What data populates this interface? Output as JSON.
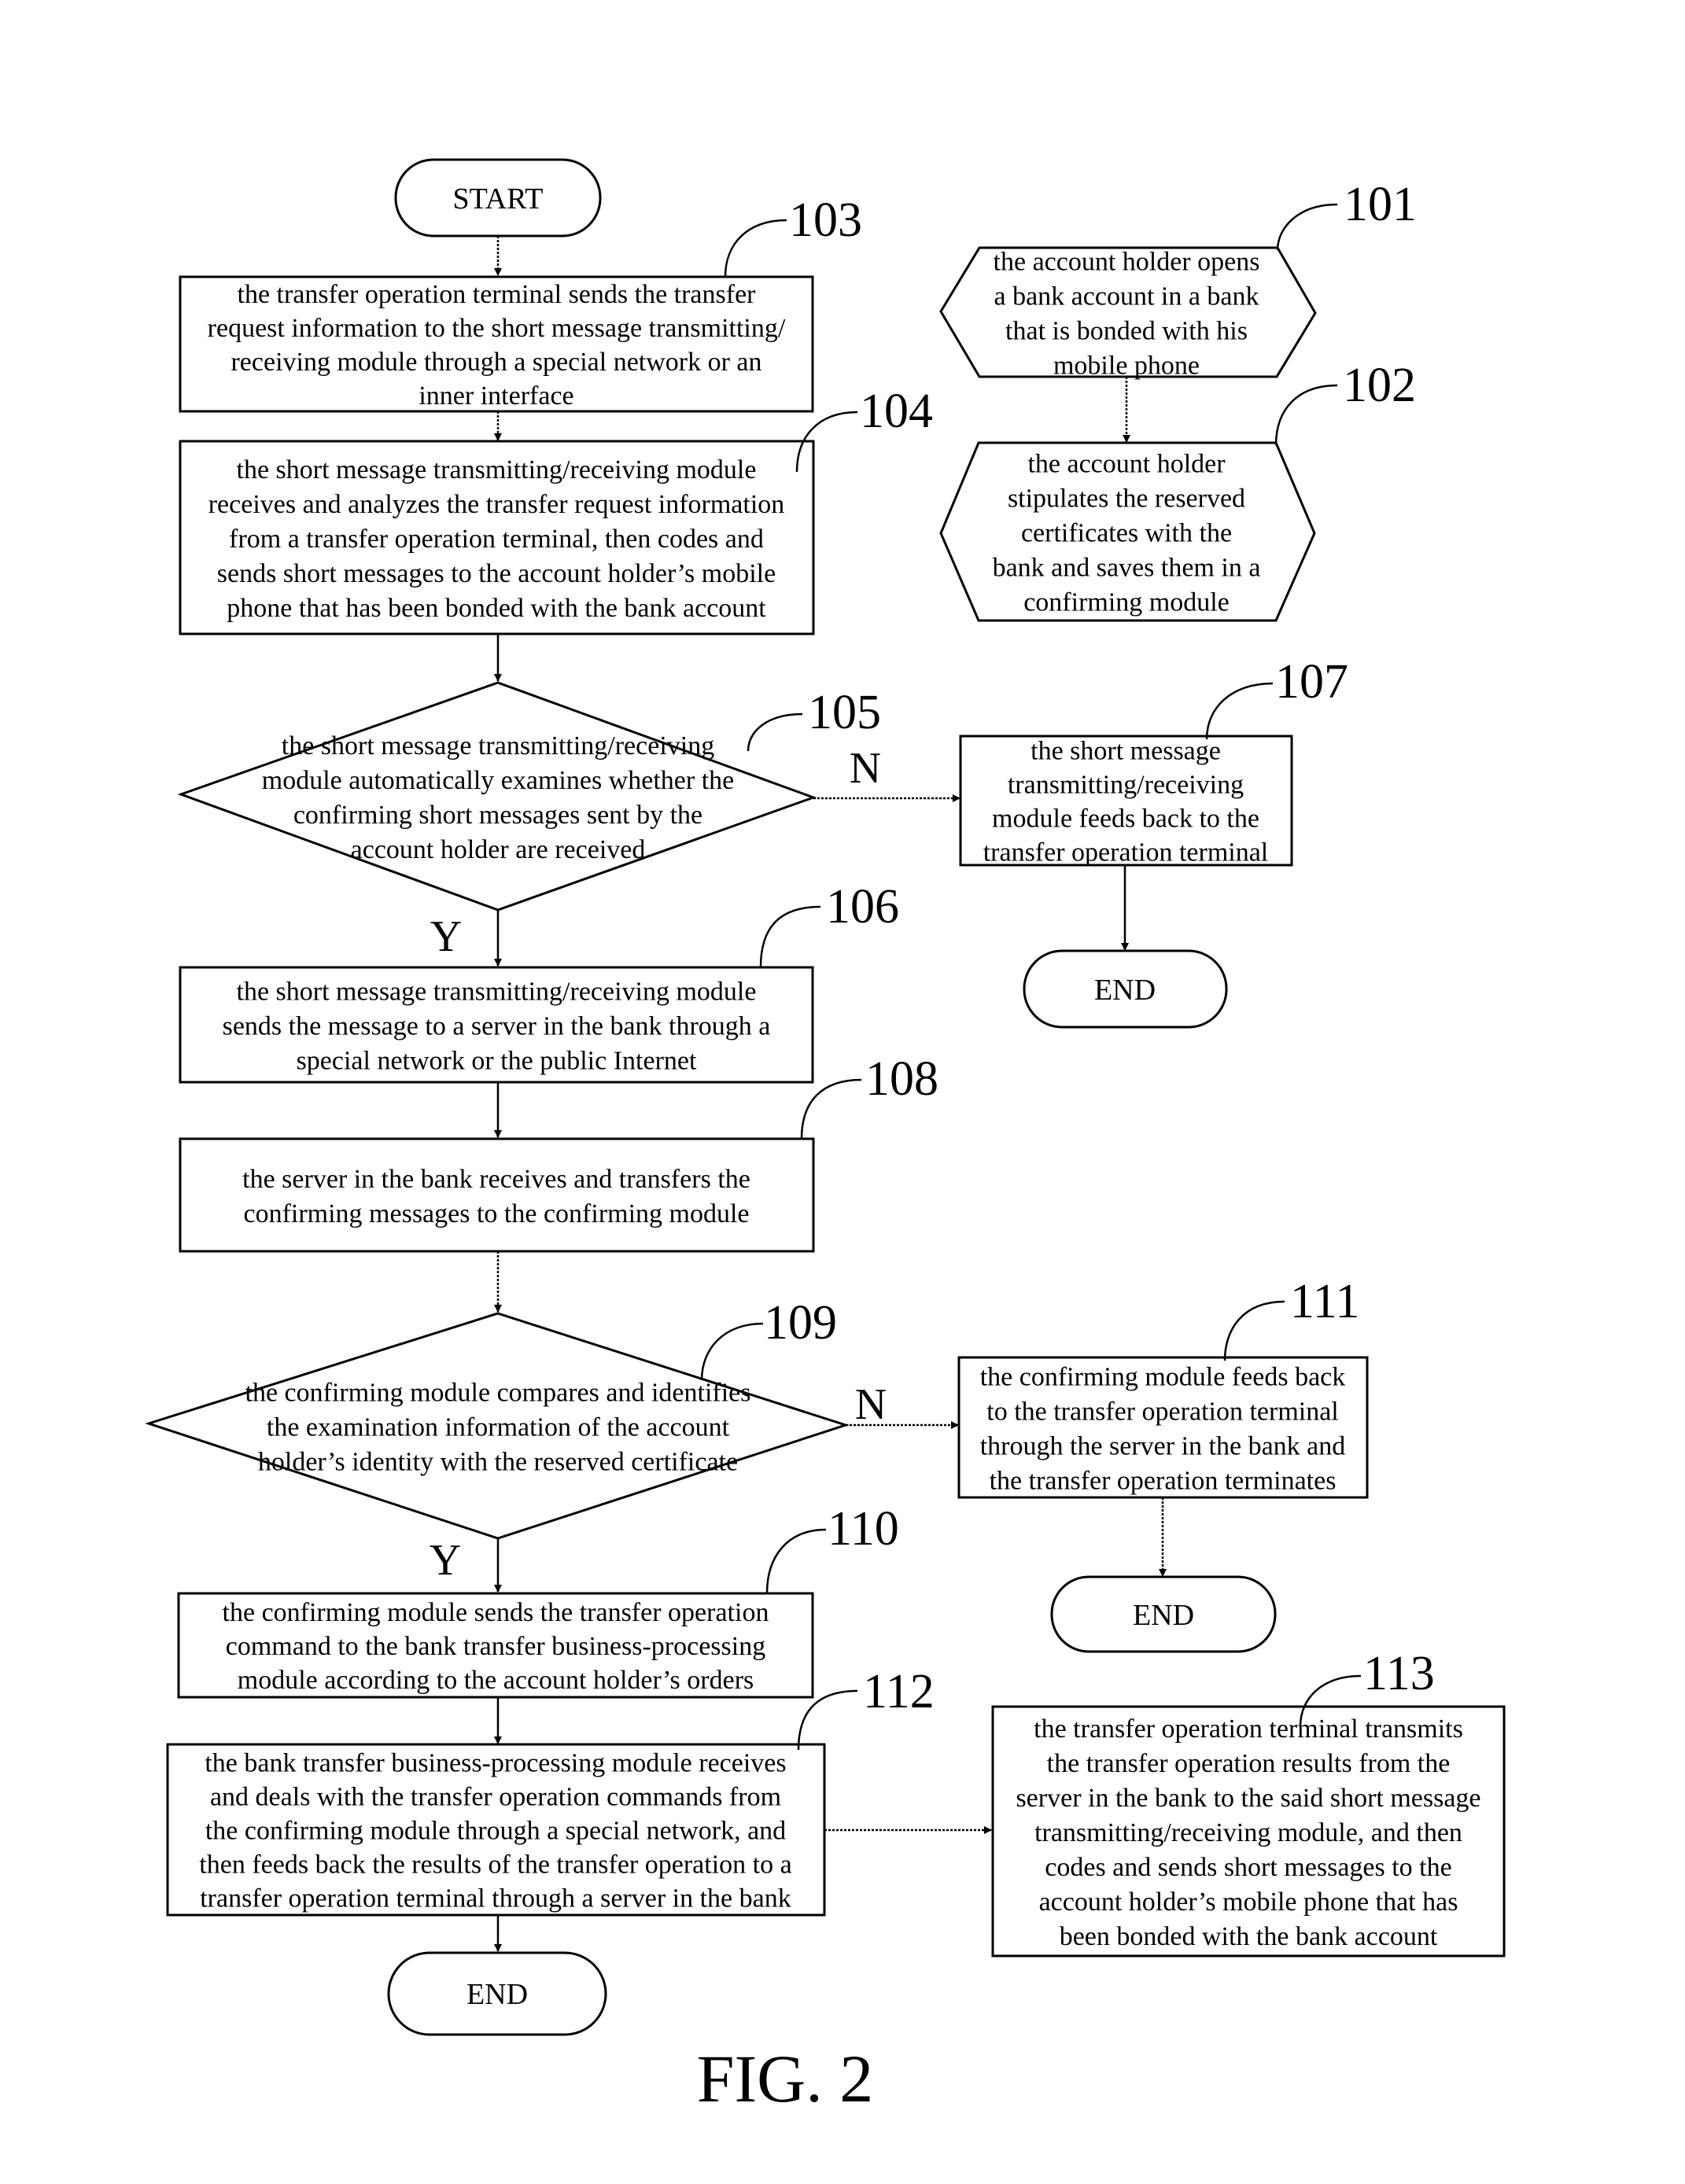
{
  "figure": {
    "title": "FIG. 2",
    "terminals": {
      "start": "START",
      "end": "END"
    },
    "branch_labels": {
      "yes": "Y",
      "no": "N"
    },
    "steps": {
      "101": {
        "ref": "101",
        "shape": "hexagon",
        "lines": [
          "the account holder opens",
          "a bank account in a bank",
          "that is bonded with his",
          "mobile phone"
        ]
      },
      "102": {
        "ref": "102",
        "shape": "hexagon",
        "lines": [
          "the account holder",
          "stipulates the reserved",
          "certificates with the",
          "bank and saves them in a",
          "confirming module"
        ]
      },
      "103": {
        "ref": "103",
        "shape": "process",
        "lines": [
          "the transfer operation terminal sends the transfer",
          "request information to the short message transmitting/",
          "receiving module through a special network or an",
          "inner interface"
        ]
      },
      "104": {
        "ref": "104",
        "shape": "process",
        "lines": [
          "the short message transmitting/receiving module",
          "receives and analyzes the transfer request information",
          "from a transfer operation terminal, then codes and",
          "sends short messages to the account holder’s mobile",
          "phone that has been bonded with the bank account"
        ]
      },
      "105": {
        "ref": "105",
        "shape": "decision",
        "lines": [
          "the short message transmitting/receiving",
          "module automatically examines whether the",
          "confirming short messages sent by the",
          "account holder are received"
        ]
      },
      "106": {
        "ref": "106",
        "shape": "process",
        "lines": [
          "the short message transmitting/receiving module",
          "sends the message to a server in the bank through a",
          "special network or the public Internet"
        ]
      },
      "107": {
        "ref": "107",
        "shape": "process",
        "lines": [
          "the short message",
          "transmitting/receiving",
          "module feeds back to the",
          "transfer operation terminal"
        ]
      },
      "108": {
        "ref": "108",
        "shape": "process",
        "lines": [
          "the server in the bank receives and transfers the",
          "confirming messages to the confirming module"
        ]
      },
      "109": {
        "ref": "109",
        "shape": "decision",
        "lines": [
          "the confirming module compares and identifies",
          "the examination information of the account",
          "holder’s identity with the reserved certificate"
        ]
      },
      "110": {
        "ref": "110",
        "shape": "process",
        "lines": [
          "the confirming module sends the transfer operation",
          "command to the bank transfer business-processing",
          "module according to the account holder’s orders"
        ]
      },
      "111": {
        "ref": "111",
        "shape": "process",
        "lines": [
          "the confirming module feeds back",
          "to the transfer operation terminal",
          "through the server in the bank and",
          "the transfer operation terminates"
        ]
      },
      "112": {
        "ref": "112",
        "shape": "process",
        "lines": [
          "the bank transfer business-processing module receives",
          "and deals with the transfer operation commands from",
          "the confirming module through a special network, and",
          "then feeds back the results of the transfer operation to a",
          "transfer operation terminal through a server in the bank"
        ]
      },
      "113": {
        "ref": "113",
        "shape": "process",
        "lines": [
          "the transfer operation terminal transmits",
          "the transfer operation results from the",
          "server in the bank to the said short message",
          "transmitting/receiving module, and then",
          "codes and sends short messages to the",
          "account holder’s mobile phone that has",
          "been bonded with the bank account"
        ]
      }
    },
    "edges": [
      {
        "from": "start",
        "to": "103",
        "label": ""
      },
      {
        "from": "103",
        "to": "104",
        "label": ""
      },
      {
        "from": "104",
        "to": "105",
        "label": ""
      },
      {
        "from": "105",
        "to": "106",
        "label": "Y"
      },
      {
        "from": "105",
        "to": "107",
        "label": "N"
      },
      {
        "from": "107",
        "to": "end",
        "label": ""
      },
      {
        "from": "106",
        "to": "108",
        "label": ""
      },
      {
        "from": "108",
        "to": "109",
        "label": ""
      },
      {
        "from": "109",
        "to": "110",
        "label": "Y"
      },
      {
        "from": "109",
        "to": "111",
        "label": "N"
      },
      {
        "from": "111",
        "to": "end",
        "label": ""
      },
      {
        "from": "110",
        "to": "112",
        "label": ""
      },
      {
        "from": "112",
        "to": "113",
        "label": ""
      },
      {
        "from": "112",
        "to": "end",
        "label": ""
      },
      {
        "from": "101",
        "to": "102",
        "label": ""
      }
    ]
  }
}
